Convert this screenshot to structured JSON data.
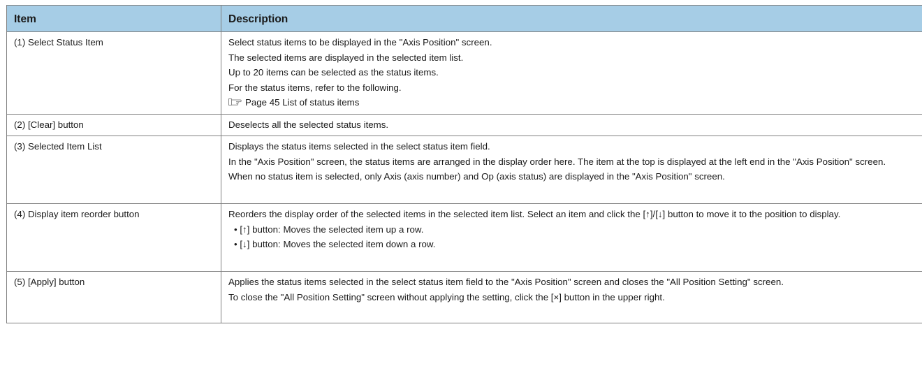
{
  "header": {
    "item": "Item",
    "description": "Description"
  },
  "rows": [
    {
      "item": "(1) Select Status Item",
      "desc": [
        "Select status items to be displayed in the \"Axis Position\" screen.",
        "The selected items are displayed in the selected item list.",
        "Up to 20 items can be selected as the status items.",
        "For the status items, refer to the following."
      ],
      "ref": "Page 45 List of status items"
    },
    {
      "item": "(2) [Clear] button",
      "desc": [
        "Deselects all the selected status items."
      ]
    },
    {
      "item": "(3) Selected Item List",
      "desc": [
        "Displays the status items selected in the select status item field.",
        "In the \"Axis Position\" screen, the status items are arranged in the display order here. The item at the top is displayed at the left end in the \"Axis Position\" screen.",
        "When no status item is selected, only Axis (axis number) and Op (axis status) are displayed in the \"Axis Position\" screen."
      ]
    },
    {
      "item": "(4) Display item reorder button",
      "desc": [
        "Reorders the display order of the selected items in the selected item list. Select an item and click the [↑]/[↓] button to move it to the position to display."
      ],
      "bullets": [
        "[↑] button: Moves the selected item up a row.",
        "[↓] button: Moves the selected item down a row."
      ]
    },
    {
      "item": "(5) [Apply] button",
      "desc": [
        "Applies the status items selected in the select status item field to the \"Axis Position\" screen and closes the \"All Position Setting\" screen.",
        "To close the \"All Position Setting\" screen without applying the setting, click the [×] button in the upper right."
      ]
    }
  ],
  "icons": {
    "reference": "pointing-hand-icon"
  }
}
